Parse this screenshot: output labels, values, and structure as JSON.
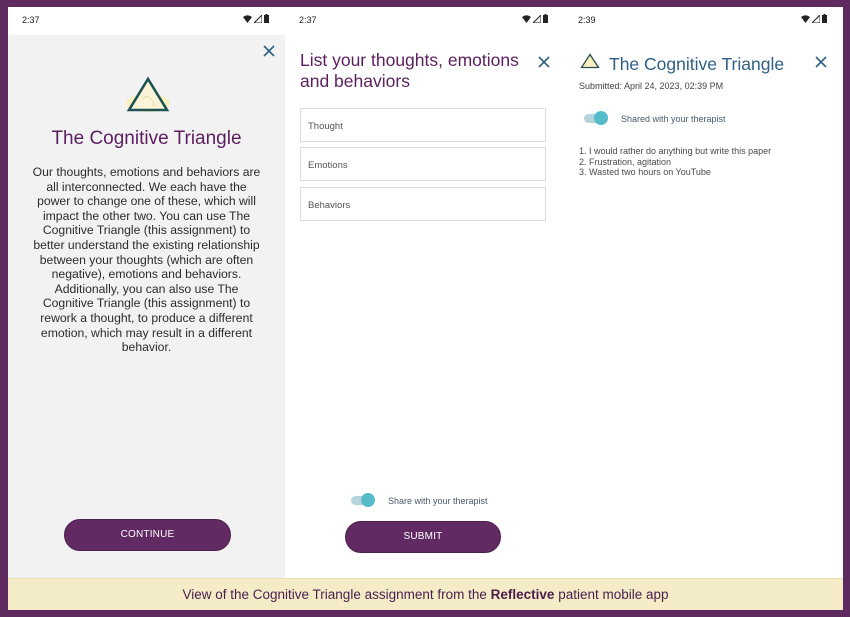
{
  "caption": {
    "prefix": "View of the Cognitive Triangle assignment from the ",
    "brand": "Reflective",
    "suffix": " patient mobile app"
  },
  "screens": [
    {
      "status_time": "2:37",
      "status_icons": [
        "wifi-icon",
        "signal-icon",
        "battery-icon"
      ],
      "close_icon": "close-icon",
      "title": "The Cognitive Triangle",
      "description": "Our thoughts, emotions and behaviors are all interconnected. We each have the power to change one of these, which will impact the other two. You can use The Cognitive Triangle (this assignment) to better understand the existing relationship between your thoughts (which are often negative), emotions and behaviors. Additionally, you can also use The Cognitive Triangle (this assignment) to rework a thought, to produce a different emotion, which may result in a different behavior.",
      "button_label": "CONTINUE"
    },
    {
      "status_time": "2:37",
      "title": "List your thoughts, emotions and behaviors",
      "fields": [
        {
          "placeholder": "Thought",
          "value": ""
        },
        {
          "placeholder": "Emotions",
          "value": ""
        },
        {
          "placeholder": "Behaviors",
          "value": ""
        }
      ],
      "share_toggle": {
        "label": "Share with your therapist",
        "on": true
      },
      "button_label": "SUBMIT"
    },
    {
      "status_time": "2:39",
      "title": "The Cognitive Triangle",
      "submitted": "Submitted: April 24, 2023, 02:39 PM",
      "shared_toggle": {
        "label": "Shared with your therapist",
        "on": true
      },
      "answers": [
        "1. I would rather do anything but write this paper",
        "2. Frustration, agitation",
        "3. Wasted two hours on YouTube"
      ]
    }
  ],
  "colors": {
    "frame": "#5e2a60",
    "title_purple": "#5b1f5e",
    "button": "#622a63",
    "title_blue": "#2e6185",
    "toggle": "#56bccc",
    "caption_bg": "#f4ebc7",
    "close_icon": "#2e6185"
  }
}
